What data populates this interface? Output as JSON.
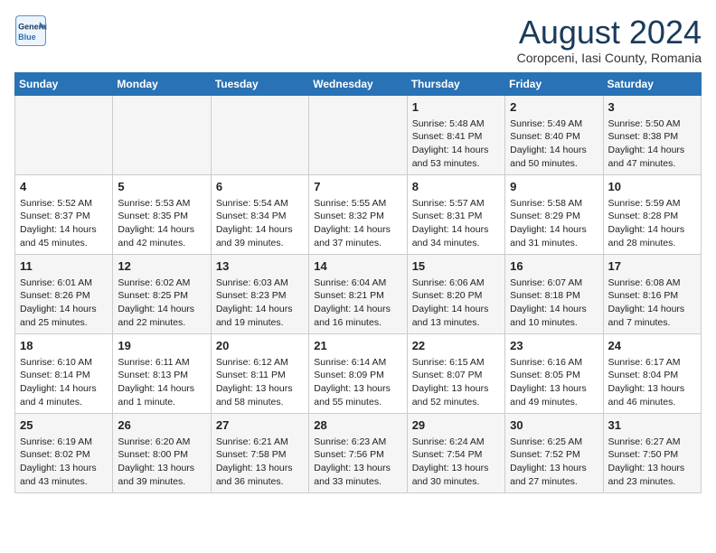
{
  "header": {
    "logo_line1": "General",
    "logo_line2": "Blue",
    "title": "August 2024",
    "subtitle": "Coropceni, Iasi County, Romania"
  },
  "weekdays": [
    "Sunday",
    "Monday",
    "Tuesday",
    "Wednesday",
    "Thursday",
    "Friday",
    "Saturday"
  ],
  "weeks": [
    [
      {
        "day": "",
        "info": ""
      },
      {
        "day": "",
        "info": ""
      },
      {
        "day": "",
        "info": ""
      },
      {
        "day": "",
        "info": ""
      },
      {
        "day": "1",
        "info": "Sunrise: 5:48 AM\nSunset: 8:41 PM\nDaylight: 14 hours\nand 53 minutes."
      },
      {
        "day": "2",
        "info": "Sunrise: 5:49 AM\nSunset: 8:40 PM\nDaylight: 14 hours\nand 50 minutes."
      },
      {
        "day": "3",
        "info": "Sunrise: 5:50 AM\nSunset: 8:38 PM\nDaylight: 14 hours\nand 47 minutes."
      }
    ],
    [
      {
        "day": "4",
        "info": "Sunrise: 5:52 AM\nSunset: 8:37 PM\nDaylight: 14 hours\nand 45 minutes."
      },
      {
        "day": "5",
        "info": "Sunrise: 5:53 AM\nSunset: 8:35 PM\nDaylight: 14 hours\nand 42 minutes."
      },
      {
        "day": "6",
        "info": "Sunrise: 5:54 AM\nSunset: 8:34 PM\nDaylight: 14 hours\nand 39 minutes."
      },
      {
        "day": "7",
        "info": "Sunrise: 5:55 AM\nSunset: 8:32 PM\nDaylight: 14 hours\nand 37 minutes."
      },
      {
        "day": "8",
        "info": "Sunrise: 5:57 AM\nSunset: 8:31 PM\nDaylight: 14 hours\nand 34 minutes."
      },
      {
        "day": "9",
        "info": "Sunrise: 5:58 AM\nSunset: 8:29 PM\nDaylight: 14 hours\nand 31 minutes."
      },
      {
        "day": "10",
        "info": "Sunrise: 5:59 AM\nSunset: 8:28 PM\nDaylight: 14 hours\nand 28 minutes."
      }
    ],
    [
      {
        "day": "11",
        "info": "Sunrise: 6:01 AM\nSunset: 8:26 PM\nDaylight: 14 hours\nand 25 minutes."
      },
      {
        "day": "12",
        "info": "Sunrise: 6:02 AM\nSunset: 8:25 PM\nDaylight: 14 hours\nand 22 minutes."
      },
      {
        "day": "13",
        "info": "Sunrise: 6:03 AM\nSunset: 8:23 PM\nDaylight: 14 hours\nand 19 minutes."
      },
      {
        "day": "14",
        "info": "Sunrise: 6:04 AM\nSunset: 8:21 PM\nDaylight: 14 hours\nand 16 minutes."
      },
      {
        "day": "15",
        "info": "Sunrise: 6:06 AM\nSunset: 8:20 PM\nDaylight: 14 hours\nand 13 minutes."
      },
      {
        "day": "16",
        "info": "Sunrise: 6:07 AM\nSunset: 8:18 PM\nDaylight: 14 hours\nand 10 minutes."
      },
      {
        "day": "17",
        "info": "Sunrise: 6:08 AM\nSunset: 8:16 PM\nDaylight: 14 hours\nand 7 minutes."
      }
    ],
    [
      {
        "day": "18",
        "info": "Sunrise: 6:10 AM\nSunset: 8:14 PM\nDaylight: 14 hours\nand 4 minutes."
      },
      {
        "day": "19",
        "info": "Sunrise: 6:11 AM\nSunset: 8:13 PM\nDaylight: 14 hours\nand 1 minute."
      },
      {
        "day": "20",
        "info": "Sunrise: 6:12 AM\nSunset: 8:11 PM\nDaylight: 13 hours\nand 58 minutes."
      },
      {
        "day": "21",
        "info": "Sunrise: 6:14 AM\nSunset: 8:09 PM\nDaylight: 13 hours\nand 55 minutes."
      },
      {
        "day": "22",
        "info": "Sunrise: 6:15 AM\nSunset: 8:07 PM\nDaylight: 13 hours\nand 52 minutes."
      },
      {
        "day": "23",
        "info": "Sunrise: 6:16 AM\nSunset: 8:05 PM\nDaylight: 13 hours\nand 49 minutes."
      },
      {
        "day": "24",
        "info": "Sunrise: 6:17 AM\nSunset: 8:04 PM\nDaylight: 13 hours\nand 46 minutes."
      }
    ],
    [
      {
        "day": "25",
        "info": "Sunrise: 6:19 AM\nSunset: 8:02 PM\nDaylight: 13 hours\nand 43 minutes."
      },
      {
        "day": "26",
        "info": "Sunrise: 6:20 AM\nSunset: 8:00 PM\nDaylight: 13 hours\nand 39 minutes."
      },
      {
        "day": "27",
        "info": "Sunrise: 6:21 AM\nSunset: 7:58 PM\nDaylight: 13 hours\nand 36 minutes."
      },
      {
        "day": "28",
        "info": "Sunrise: 6:23 AM\nSunset: 7:56 PM\nDaylight: 13 hours\nand 33 minutes."
      },
      {
        "day": "29",
        "info": "Sunrise: 6:24 AM\nSunset: 7:54 PM\nDaylight: 13 hours\nand 30 minutes."
      },
      {
        "day": "30",
        "info": "Sunrise: 6:25 AM\nSunset: 7:52 PM\nDaylight: 13 hours\nand 27 minutes."
      },
      {
        "day": "31",
        "info": "Sunrise: 6:27 AM\nSunset: 7:50 PM\nDaylight: 13 hours\nand 23 minutes."
      }
    ]
  ]
}
